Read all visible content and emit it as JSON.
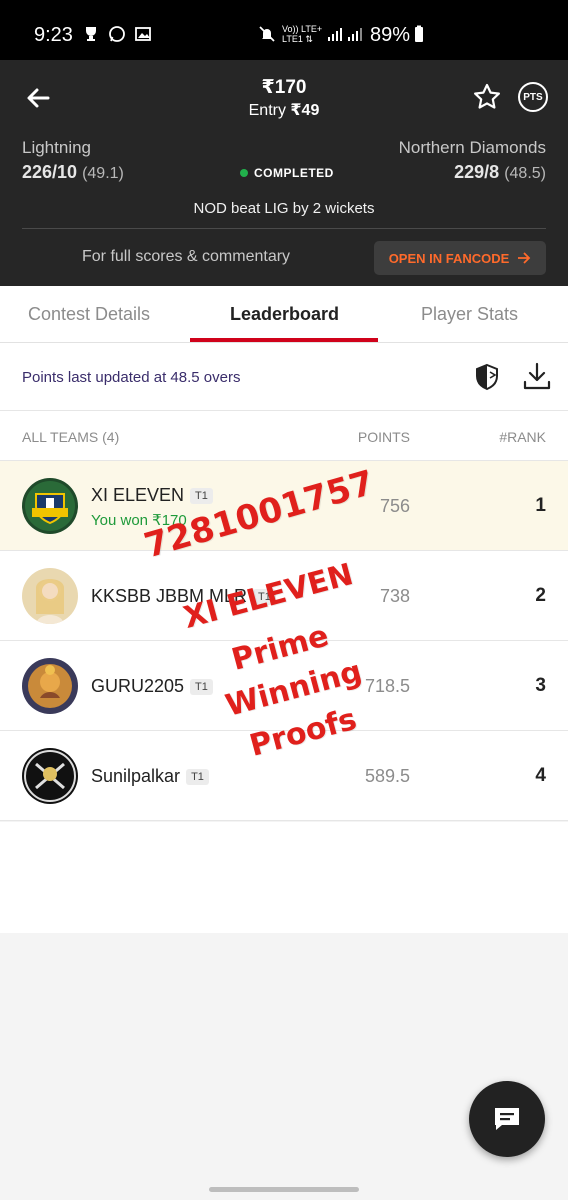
{
  "status_bar": {
    "time": "9:23",
    "lte_top": "Vo)) LTE+",
    "lte_bottom": "LTE1 ⇅",
    "battery": "89%"
  },
  "header": {
    "prize": "₹170",
    "entry_label": "Entry",
    "entry_amount": "₹49",
    "pts_label": "PTS",
    "team_left": {
      "name": "Lightning",
      "score": "226/10",
      "overs": "(49.1)"
    },
    "team_right": {
      "name": "Northern Diamonds",
      "score": "229/8",
      "overs": "(48.5)"
    },
    "match_status": "COMPLETED",
    "result": "NOD beat LIG by 2 wickets",
    "full_scores_text": "For full scores & commentary",
    "fancode_button": "OPEN IN FANCODE"
  },
  "tabs": [
    {
      "label": "Contest Details",
      "active": false
    },
    {
      "label": "Leaderboard",
      "active": true
    },
    {
      "label": "Player Stats",
      "active": false
    }
  ],
  "points_updated": "Points last updated at 48.5 overs",
  "columns": {
    "teams": "ALL TEAMS (4)",
    "points": "POINTS",
    "rank": "#RANK"
  },
  "leaderboard": [
    {
      "name": "XI ELEVEN",
      "badge": "T1",
      "won": "You won ₹170",
      "points": "756",
      "rank": "1"
    },
    {
      "name": "KKSBB JBBM MLR",
      "badge": "T1",
      "points": "738",
      "rank": "2"
    },
    {
      "name": "GURU2205",
      "badge": "T1",
      "points": "718.5",
      "rank": "3"
    },
    {
      "name": "Sunilpalkar",
      "badge": "T1",
      "points": "589.5",
      "rank": "4"
    }
  ],
  "watermark": {
    "line1": "7281001757",
    "line2": "XI ELEVEN",
    "line3": "Prime",
    "line4": "Winning",
    "line5": "Proofs"
  },
  "colors": {
    "accent_red": "#d0021b",
    "fancode_orange": "#ff6a2b",
    "header_bg": "#262626",
    "won_green": "#1e9a3a"
  }
}
